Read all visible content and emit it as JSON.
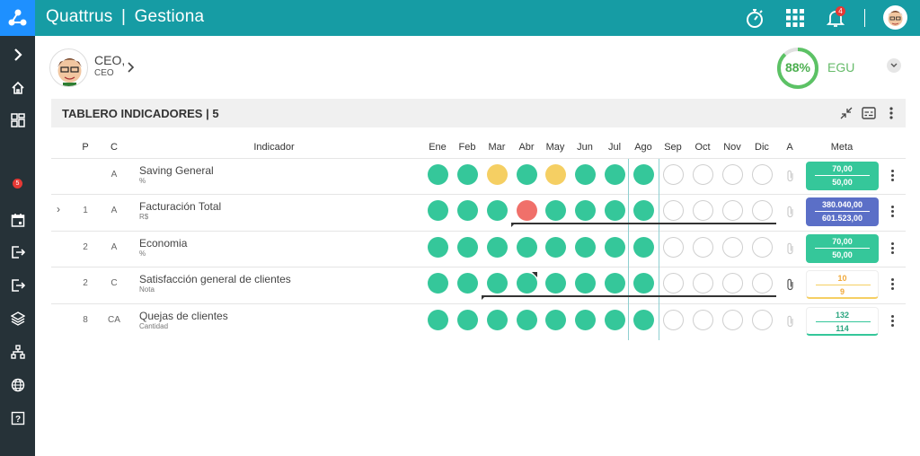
{
  "app": {
    "brand": "Quattrus",
    "separator": "|",
    "module": "Gestiona"
  },
  "topbar": {
    "notifications_count": "4",
    "icons": [
      "stopwatch-icon",
      "apps-grid-icon",
      "bell-icon",
      "avatar"
    ]
  },
  "sidebar": {
    "items": [
      "chevron-right-icon",
      "home-icon",
      "dashboard-icon",
      "badge",
      "calendar-icon",
      "exit-icon",
      "exit-icon",
      "layers-icon",
      "sitemap-icon",
      "globe-icon",
      "help-icon"
    ],
    "badge_count": "5"
  },
  "user": {
    "name": "CEO,",
    "role": "CEO"
  },
  "gauge": {
    "value": "88%",
    "percent": 88,
    "label": "EGU"
  },
  "panel": {
    "title": "TABLERO INDICADORES | 5"
  },
  "table": {
    "headers": {
      "p": "P",
      "c": "C",
      "indicator": "Indicador",
      "a": "A",
      "meta": "Meta"
    },
    "months": [
      "Ene",
      "Feb",
      "Mar",
      "Abr",
      "May",
      "Jun",
      "Jul",
      "Ago",
      "Sep",
      "Oct",
      "Nov",
      "Dic"
    ],
    "rows": [
      {
        "p": "",
        "c": "A",
        "name": "Saving General",
        "unit": "%",
        "status": [
          "g",
          "g",
          "y",
          "g",
          "y",
          "g",
          "g",
          "g",
          "e",
          "e",
          "e",
          "e"
        ],
        "meta_top": "70,00",
        "meta_bottom": "50,00",
        "meta_style": "green",
        "expand": "",
        "attachment": false
      },
      {
        "p": "1",
        "c": "A",
        "name": "Facturación Total",
        "unit": "R$",
        "status": [
          "g",
          "g",
          "g",
          "r",
          "g",
          "g",
          "g",
          "g",
          "e",
          "e",
          "e",
          "e"
        ],
        "meta_top": "380.040,00",
        "meta_bottom": "601.523,00",
        "meta_style": "blue",
        "expand": "›",
        "attachment": false
      },
      {
        "p": "2",
        "c": "A",
        "name": "Economia",
        "unit": "%",
        "status": [
          "g",
          "g",
          "g",
          "g",
          "g",
          "g",
          "g",
          "g",
          "e",
          "e",
          "e",
          "e"
        ],
        "meta_top": "70,00",
        "meta_bottom": "50,00",
        "meta_style": "green",
        "expand": "",
        "attachment": false
      },
      {
        "p": "2",
        "c": "C",
        "name": "Satisfacción general de clientes",
        "unit": "Nota",
        "status": [
          "g",
          "g",
          "g",
          "g",
          "g",
          "g",
          "g",
          "g",
          "e",
          "e",
          "e",
          "e"
        ],
        "meta_top": "10",
        "meta_bottom": "9",
        "meta_style": "outline-yellow",
        "expand": "",
        "attachment": true
      },
      {
        "p": "8",
        "c": "CA",
        "name": "Quejas de clientes",
        "unit": "Cantidad",
        "status": [
          "g",
          "g",
          "g",
          "g",
          "g",
          "g",
          "g",
          "g",
          "e",
          "e",
          "e",
          "e"
        ],
        "meta_top": "132",
        "meta_bottom": "114",
        "meta_style": "outline-green",
        "expand": "",
        "attachment": false
      }
    ]
  },
  "colors": {
    "topbar": "#169ca4",
    "sidebar": "#263238",
    "green": "#35c79a",
    "yellow": "#f5cf63",
    "red": "#f0706a",
    "blue_meta": "#5b6fc7"
  }
}
